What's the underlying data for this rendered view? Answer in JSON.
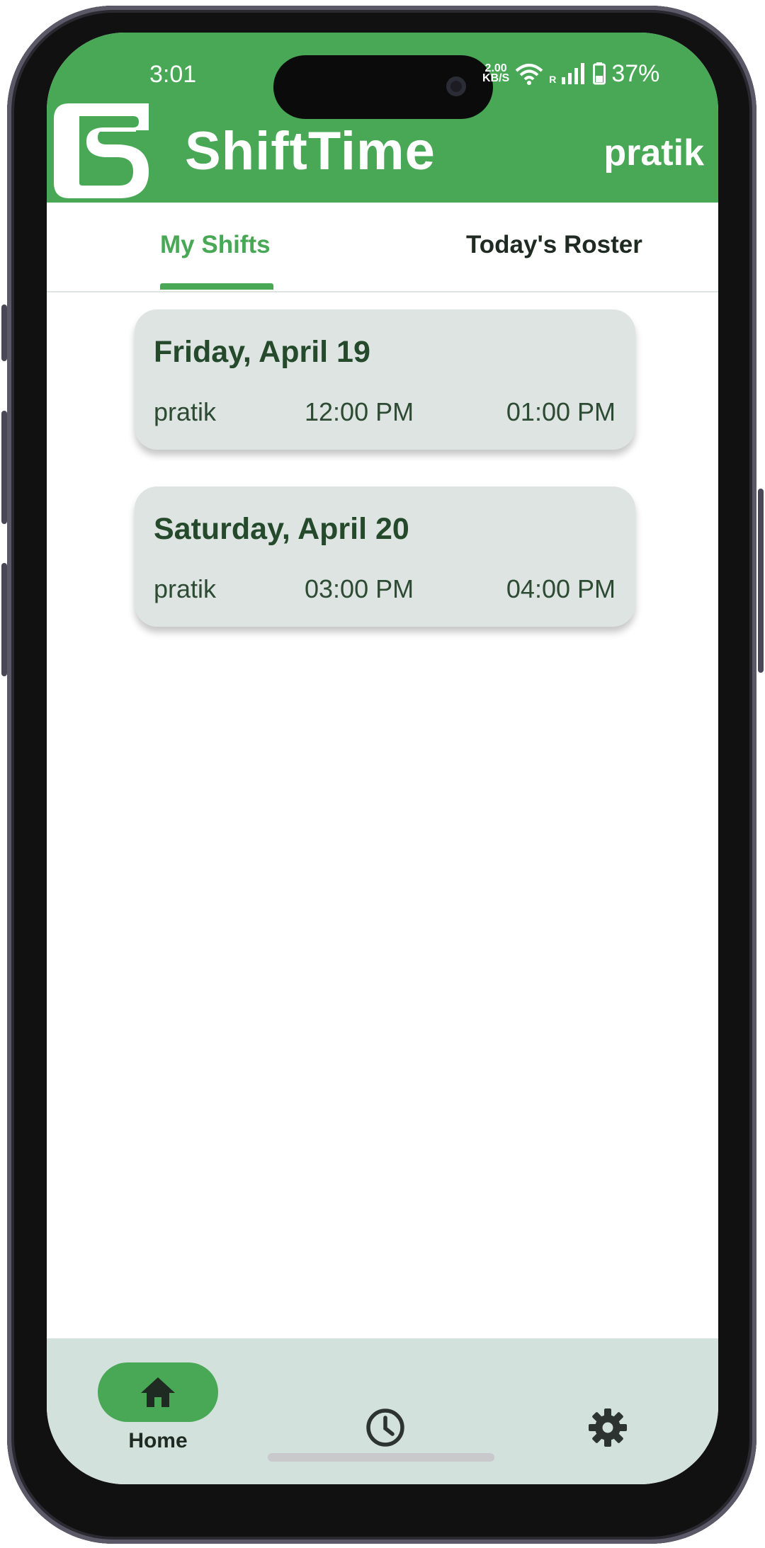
{
  "status_bar": {
    "time": "3:01",
    "net_speed_value": "2.00",
    "net_speed_unit": "KB/S",
    "signal_roaming": "R",
    "battery": "37%"
  },
  "header": {
    "app_name": "ShiftTime",
    "user": "pratik",
    "brand_color": "#48a856"
  },
  "tabs": [
    {
      "label": "My Shifts",
      "active": true
    },
    {
      "label": "Today's Roster",
      "active": false
    }
  ],
  "shifts": [
    {
      "date": "Friday, April 19",
      "name": "pratik",
      "start": "12:00 PM",
      "end": "01:00 PM"
    },
    {
      "date": "Saturday, April 20",
      "name": "pratik",
      "start": "03:00 PM",
      "end": "04:00 PM"
    }
  ],
  "bottom_nav": {
    "items": [
      {
        "label": "Home",
        "icon": "home-icon",
        "active": true
      },
      {
        "label": "",
        "icon": "clock-icon",
        "active": false
      },
      {
        "label": "",
        "icon": "gear-icon",
        "active": false
      }
    ]
  }
}
